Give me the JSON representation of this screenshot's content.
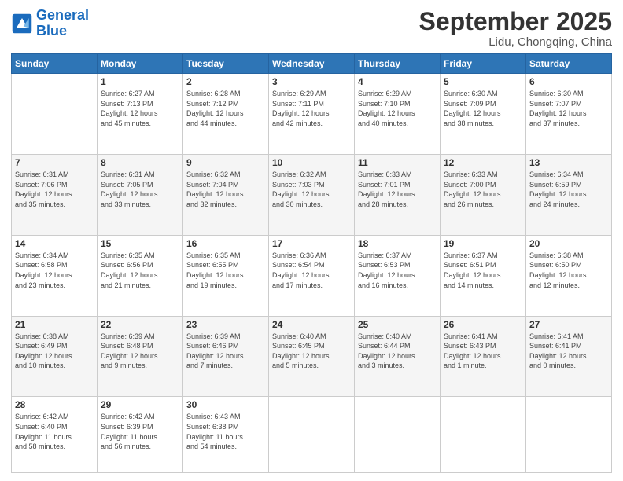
{
  "logo": {
    "line1": "General",
    "line2": "Blue"
  },
  "title": "September 2025",
  "subtitle": "Lidu, Chongqing, China",
  "days_of_week": [
    "Sunday",
    "Monday",
    "Tuesday",
    "Wednesday",
    "Thursday",
    "Friday",
    "Saturday"
  ],
  "weeks": [
    [
      {
        "day": "",
        "info": ""
      },
      {
        "day": "1",
        "info": "Sunrise: 6:27 AM\nSunset: 7:13 PM\nDaylight: 12 hours\nand 45 minutes."
      },
      {
        "day": "2",
        "info": "Sunrise: 6:28 AM\nSunset: 7:12 PM\nDaylight: 12 hours\nand 44 minutes."
      },
      {
        "day": "3",
        "info": "Sunrise: 6:29 AM\nSunset: 7:11 PM\nDaylight: 12 hours\nand 42 minutes."
      },
      {
        "day": "4",
        "info": "Sunrise: 6:29 AM\nSunset: 7:10 PM\nDaylight: 12 hours\nand 40 minutes."
      },
      {
        "day": "5",
        "info": "Sunrise: 6:30 AM\nSunset: 7:09 PM\nDaylight: 12 hours\nand 38 minutes."
      },
      {
        "day": "6",
        "info": "Sunrise: 6:30 AM\nSunset: 7:07 PM\nDaylight: 12 hours\nand 37 minutes."
      }
    ],
    [
      {
        "day": "7",
        "info": "Sunrise: 6:31 AM\nSunset: 7:06 PM\nDaylight: 12 hours\nand 35 minutes."
      },
      {
        "day": "8",
        "info": "Sunrise: 6:31 AM\nSunset: 7:05 PM\nDaylight: 12 hours\nand 33 minutes."
      },
      {
        "day": "9",
        "info": "Sunrise: 6:32 AM\nSunset: 7:04 PM\nDaylight: 12 hours\nand 32 minutes."
      },
      {
        "day": "10",
        "info": "Sunrise: 6:32 AM\nSunset: 7:03 PM\nDaylight: 12 hours\nand 30 minutes."
      },
      {
        "day": "11",
        "info": "Sunrise: 6:33 AM\nSunset: 7:01 PM\nDaylight: 12 hours\nand 28 minutes."
      },
      {
        "day": "12",
        "info": "Sunrise: 6:33 AM\nSunset: 7:00 PM\nDaylight: 12 hours\nand 26 minutes."
      },
      {
        "day": "13",
        "info": "Sunrise: 6:34 AM\nSunset: 6:59 PM\nDaylight: 12 hours\nand 24 minutes."
      }
    ],
    [
      {
        "day": "14",
        "info": "Sunrise: 6:34 AM\nSunset: 6:58 PM\nDaylight: 12 hours\nand 23 minutes."
      },
      {
        "day": "15",
        "info": "Sunrise: 6:35 AM\nSunset: 6:56 PM\nDaylight: 12 hours\nand 21 minutes."
      },
      {
        "day": "16",
        "info": "Sunrise: 6:35 AM\nSunset: 6:55 PM\nDaylight: 12 hours\nand 19 minutes."
      },
      {
        "day": "17",
        "info": "Sunrise: 6:36 AM\nSunset: 6:54 PM\nDaylight: 12 hours\nand 17 minutes."
      },
      {
        "day": "18",
        "info": "Sunrise: 6:37 AM\nSunset: 6:53 PM\nDaylight: 12 hours\nand 16 minutes."
      },
      {
        "day": "19",
        "info": "Sunrise: 6:37 AM\nSunset: 6:51 PM\nDaylight: 12 hours\nand 14 minutes."
      },
      {
        "day": "20",
        "info": "Sunrise: 6:38 AM\nSunset: 6:50 PM\nDaylight: 12 hours\nand 12 minutes."
      }
    ],
    [
      {
        "day": "21",
        "info": "Sunrise: 6:38 AM\nSunset: 6:49 PM\nDaylight: 12 hours\nand 10 minutes."
      },
      {
        "day": "22",
        "info": "Sunrise: 6:39 AM\nSunset: 6:48 PM\nDaylight: 12 hours\nand 9 minutes."
      },
      {
        "day": "23",
        "info": "Sunrise: 6:39 AM\nSunset: 6:46 PM\nDaylight: 12 hours\nand 7 minutes."
      },
      {
        "day": "24",
        "info": "Sunrise: 6:40 AM\nSunset: 6:45 PM\nDaylight: 12 hours\nand 5 minutes."
      },
      {
        "day": "25",
        "info": "Sunrise: 6:40 AM\nSunset: 6:44 PM\nDaylight: 12 hours\nand 3 minutes."
      },
      {
        "day": "26",
        "info": "Sunrise: 6:41 AM\nSunset: 6:43 PM\nDaylight: 12 hours\nand 1 minute."
      },
      {
        "day": "27",
        "info": "Sunrise: 6:41 AM\nSunset: 6:41 PM\nDaylight: 12 hours\nand 0 minutes."
      }
    ],
    [
      {
        "day": "28",
        "info": "Sunrise: 6:42 AM\nSunset: 6:40 PM\nDaylight: 11 hours\nand 58 minutes."
      },
      {
        "day": "29",
        "info": "Sunrise: 6:42 AM\nSunset: 6:39 PM\nDaylight: 11 hours\nand 56 minutes."
      },
      {
        "day": "30",
        "info": "Sunrise: 6:43 AM\nSunset: 6:38 PM\nDaylight: 11 hours\nand 54 minutes."
      },
      {
        "day": "",
        "info": ""
      },
      {
        "day": "",
        "info": ""
      },
      {
        "day": "",
        "info": ""
      },
      {
        "day": "",
        "info": ""
      }
    ]
  ]
}
